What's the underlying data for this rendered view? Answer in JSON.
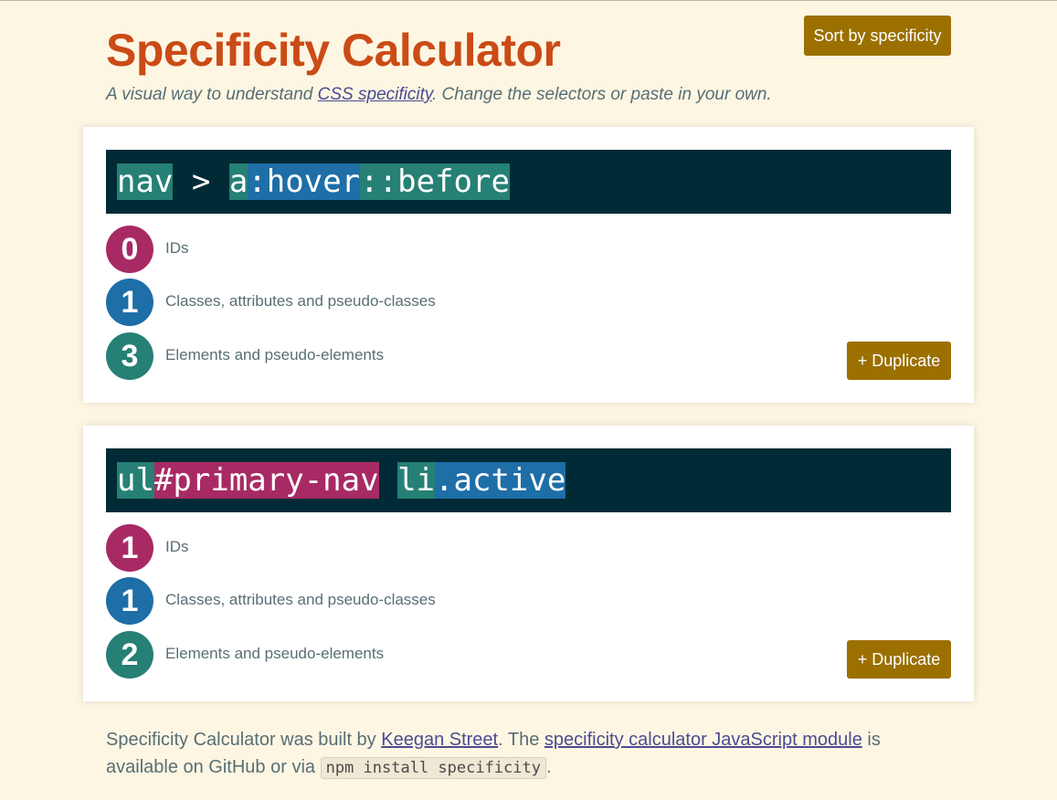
{
  "header": {
    "title": "Specificity Calculator",
    "subtitle_before": "A visual way to understand ",
    "subtitle_link": "CSS specificity",
    "subtitle_after": ". Change the selectors or paste in your own.",
    "sort_label": "Sort by specificity"
  },
  "cards": [
    {
      "tokens": [
        {
          "text": "nav",
          "type": "element"
        },
        {
          "text": " > ",
          "type": "plain"
        },
        {
          "text": "a",
          "type": "element"
        },
        {
          "text": ":hover",
          "type": "class"
        },
        {
          "text": "::before",
          "type": "element"
        }
      ],
      "counts": [
        {
          "value": "0",
          "label": "IDs"
        },
        {
          "value": "1",
          "label": "Classes, attributes and pseudo-classes"
        },
        {
          "value": "3",
          "label": "Elements and pseudo-elements"
        }
      ],
      "duplicate_label": "+ Duplicate"
    },
    {
      "tokens": [
        {
          "text": "ul",
          "type": "element"
        },
        {
          "text": "#primary-nav",
          "type": "id"
        },
        {
          "text": " ",
          "type": "plain"
        },
        {
          "text": "li",
          "type": "element"
        },
        {
          "text": ".active",
          "type": "class"
        }
      ],
      "counts": [
        {
          "value": "1",
          "label": "IDs"
        },
        {
          "value": "1",
          "label": "Classes, attributes and pseudo-classes"
        },
        {
          "value": "2",
          "label": "Elements and pseudo-elements"
        }
      ],
      "duplicate_label": "+ Duplicate"
    }
  ],
  "footer": {
    "text1": "Specificity Calculator was built by ",
    "link1": "Keegan Street",
    "text2": ". The ",
    "link2": "specificity calculator JavaScript module",
    "text3": " is available on GitHub or via ",
    "code": "npm install specificity",
    "text4": "."
  },
  "colors": {
    "background": "#fdf6e3",
    "title": "#cb4b16",
    "button": "#9b7000",
    "selector_bg": "#002b36",
    "id": "#a82a64",
    "class": "#1e6ea7",
    "element": "#268075"
  }
}
